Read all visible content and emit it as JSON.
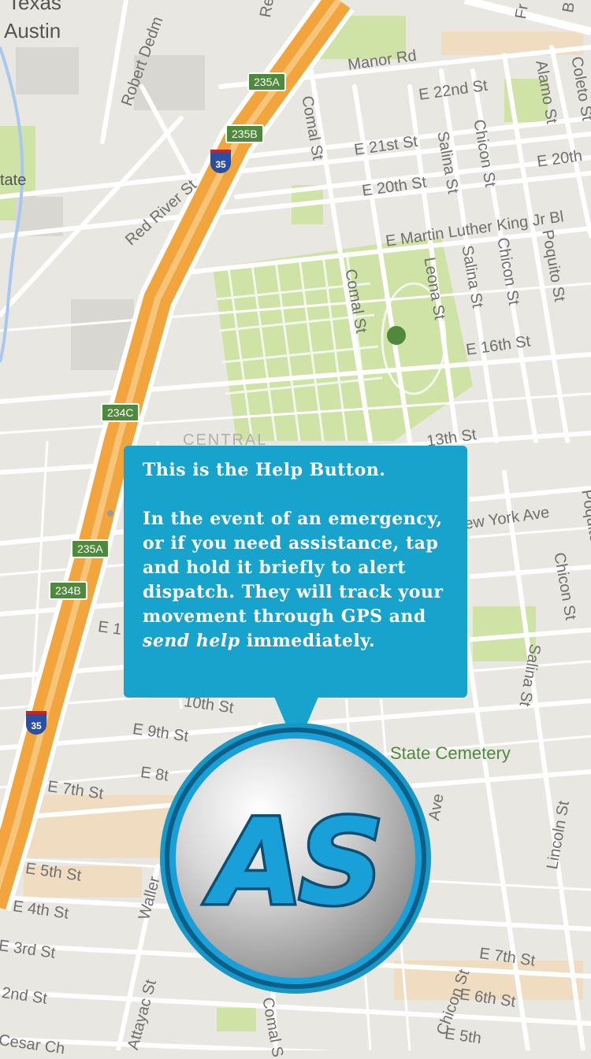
{
  "map": {
    "labels": {
      "texas": "Texas",
      "austin": "Austin",
      "tate": "tate",
      "robert_dedman": "Robert Dedm",
      "red_river": "Red River St",
      "manor": "Manor Rd",
      "e22": "E 22nd St",
      "e21": "E 21st St",
      "e20a": "E 20th St",
      "e20b": "E 20th",
      "mlk": "E Martin Luther King Jr Bl",
      "comal_top": "Comal St",
      "comal_mid": "Comal St",
      "comal_bot": "Comal S",
      "salina_top": "Salina St",
      "salina_mid": "Salina St",
      "salina_bot": "Salina St",
      "chicon_top": "Chicon St",
      "chicon_mid": "Chicon St",
      "chicon_right": "Chicon St",
      "chicon_bot": "Chicon St",
      "alamo": "Alamo St",
      "coleto": "Coleto St",
      "leona": "Leona St",
      "poquito_top": "Poquito St",
      "poquito_right": "Poquito",
      "e16": "E 16th St",
      "e13": "13th St",
      "new_york": "ew York Ave",
      "central": "CENTRAL",
      "e10": "10th St",
      "e9": "E 9th St",
      "e8": "E 8t",
      "e7_left": "E 7th St",
      "e7_right": "E 7th St",
      "e5_left": "E 5th St",
      "e5_right": "E 5th",
      "e4": "E 4th St",
      "e3": "E 3rd St",
      "e2": "2nd St",
      "e6": "E 6th St",
      "e1": "E 1",
      "cesar": "Cesar Ch",
      "waller": "Waller",
      "attayac": "Attayac St",
      "lincoln": "Lincoln St",
      "ave": "Ave",
      "state_cemetery": "State Cemetery",
      "re": "Re",
      "fr": "Fr",
      "b": "B"
    },
    "shields": {
      "s235a_top": "235A",
      "s235b": "235B",
      "s234c": "234C",
      "s235a_mid": "235A",
      "s234b": "234B",
      "i35_top": "35",
      "i35_bot": "35"
    }
  },
  "tooltip": {
    "title": "This is the Help Button.",
    "body_part1": "In the event of an emergency, or if you need assistance, tap and hold it briefly to alert dispatch. They will track your movement through GPS and ",
    "body_emph": "send help",
    "body_part2": " immediately."
  },
  "help_button": {
    "logo_text": "AS"
  },
  "colors": {
    "tooltip_bg": "#17a3cc",
    "logo_blue": "#1aa0d8",
    "highway": "#f2a53c",
    "park": "#cfe3a6"
  }
}
